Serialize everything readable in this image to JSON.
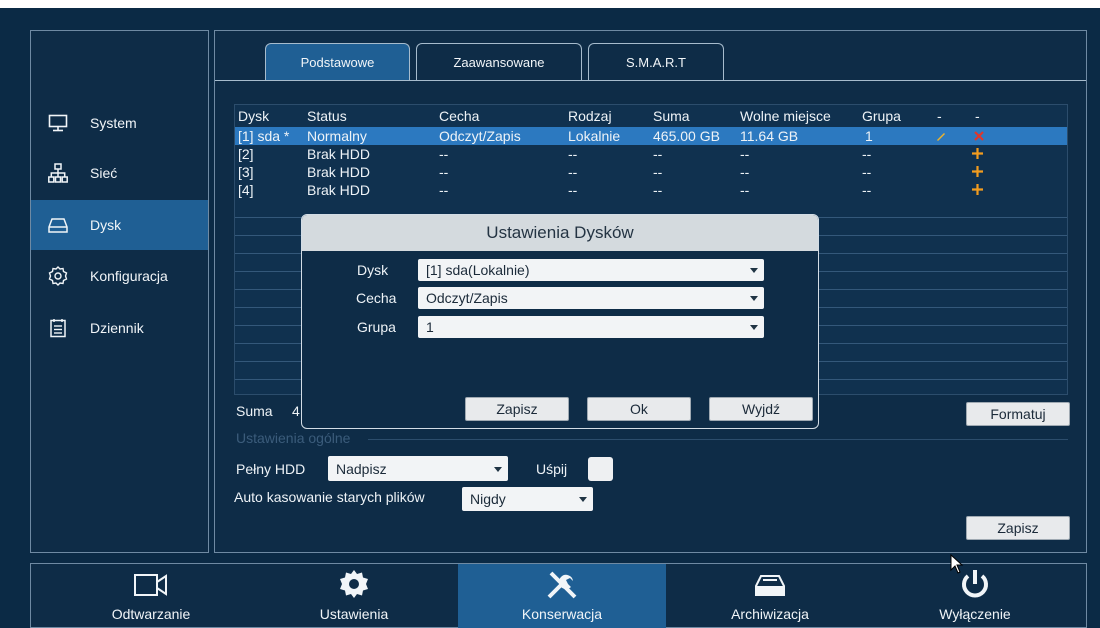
{
  "sidebar": {
    "items": [
      {
        "label": "System",
        "icon": "monitor-icon"
      },
      {
        "label": "Sieć",
        "icon": "network-icon"
      },
      {
        "label": "Dysk",
        "icon": "disk-icon",
        "active": true
      },
      {
        "label": "Konfiguracja",
        "icon": "gear-outline-icon"
      },
      {
        "label": "Dziennik",
        "icon": "log-icon"
      }
    ]
  },
  "tabs": [
    {
      "label": "Podstawowe",
      "active": true
    },
    {
      "label": "Zaawansowane"
    },
    {
      "label": "S.M.A.R.T"
    }
  ],
  "table": {
    "headers": [
      "Dysk",
      "Status",
      "Cecha",
      "Rodzaj",
      "Suma",
      "Wolne miejsce",
      "Grupa",
      "-",
      "-"
    ],
    "rows": [
      {
        "disk": "[1] sda *",
        "status": "Normalny",
        "feature": "Odczyt/Zapis",
        "type": "Lokalnie",
        "total": "465.00 GB",
        "free": "11.64 GB",
        "group": "1",
        "action": "edit",
        "action2": "delete"
      },
      {
        "disk": "[2]",
        "status": "Brak HDD",
        "feature": "--",
        "type": "--",
        "total": "--",
        "free": "--",
        "group": "--",
        "action2": "add"
      },
      {
        "disk": "[3]",
        "status": "Brak HDD",
        "feature": "--",
        "type": "--",
        "total": "--",
        "free": "--",
        "group": "--",
        "action2": "add"
      },
      {
        "disk": "[4]",
        "status": "Brak HDD",
        "feature": "--",
        "type": "--",
        "total": "--",
        "free": "--",
        "group": "--",
        "action2": "add"
      }
    ]
  },
  "summary": {
    "label": "Suma",
    "value_partial": "4"
  },
  "format_button": "Formatuj",
  "general_settings_label": "Ustawienia ogólne",
  "full_hdd": {
    "label": "Pełny HDD",
    "value": "Nadpisz"
  },
  "sleep": {
    "label": "Uśpij",
    "checked": false
  },
  "auto_delete": {
    "label": "Auto kasowanie starych plików",
    "value": "Nigdy"
  },
  "save_button": "Zapisz",
  "dialog": {
    "title": "Ustawienia Dysków",
    "fields": [
      {
        "label": "Dysk",
        "value": "[1] sda(Lokalnie)"
      },
      {
        "label": "Cecha",
        "value": "Odczyt/Zapis"
      },
      {
        "label": "Grupa",
        "value": "1"
      }
    ],
    "buttons": {
      "save": "Zapisz",
      "ok": "Ok",
      "exit": "Wyjdź"
    }
  },
  "bottom_nav": [
    {
      "label": "Odtwarzanie",
      "icon": "video-icon"
    },
    {
      "label": "Ustawienia",
      "icon": "gear-icon"
    },
    {
      "label": "Konserwacja",
      "icon": "tools-icon",
      "active": true
    },
    {
      "label": "Archiwizacja",
      "icon": "archive-drive-icon"
    },
    {
      "label": "Wyłączenie",
      "icon": "power-icon"
    }
  ],
  "colors": {
    "accent": "#1f5f94",
    "selected_row": "#2c79c0",
    "background": "#0e2c47",
    "add_icon": "#f29c1f",
    "delete_icon": "#e0362b"
  }
}
